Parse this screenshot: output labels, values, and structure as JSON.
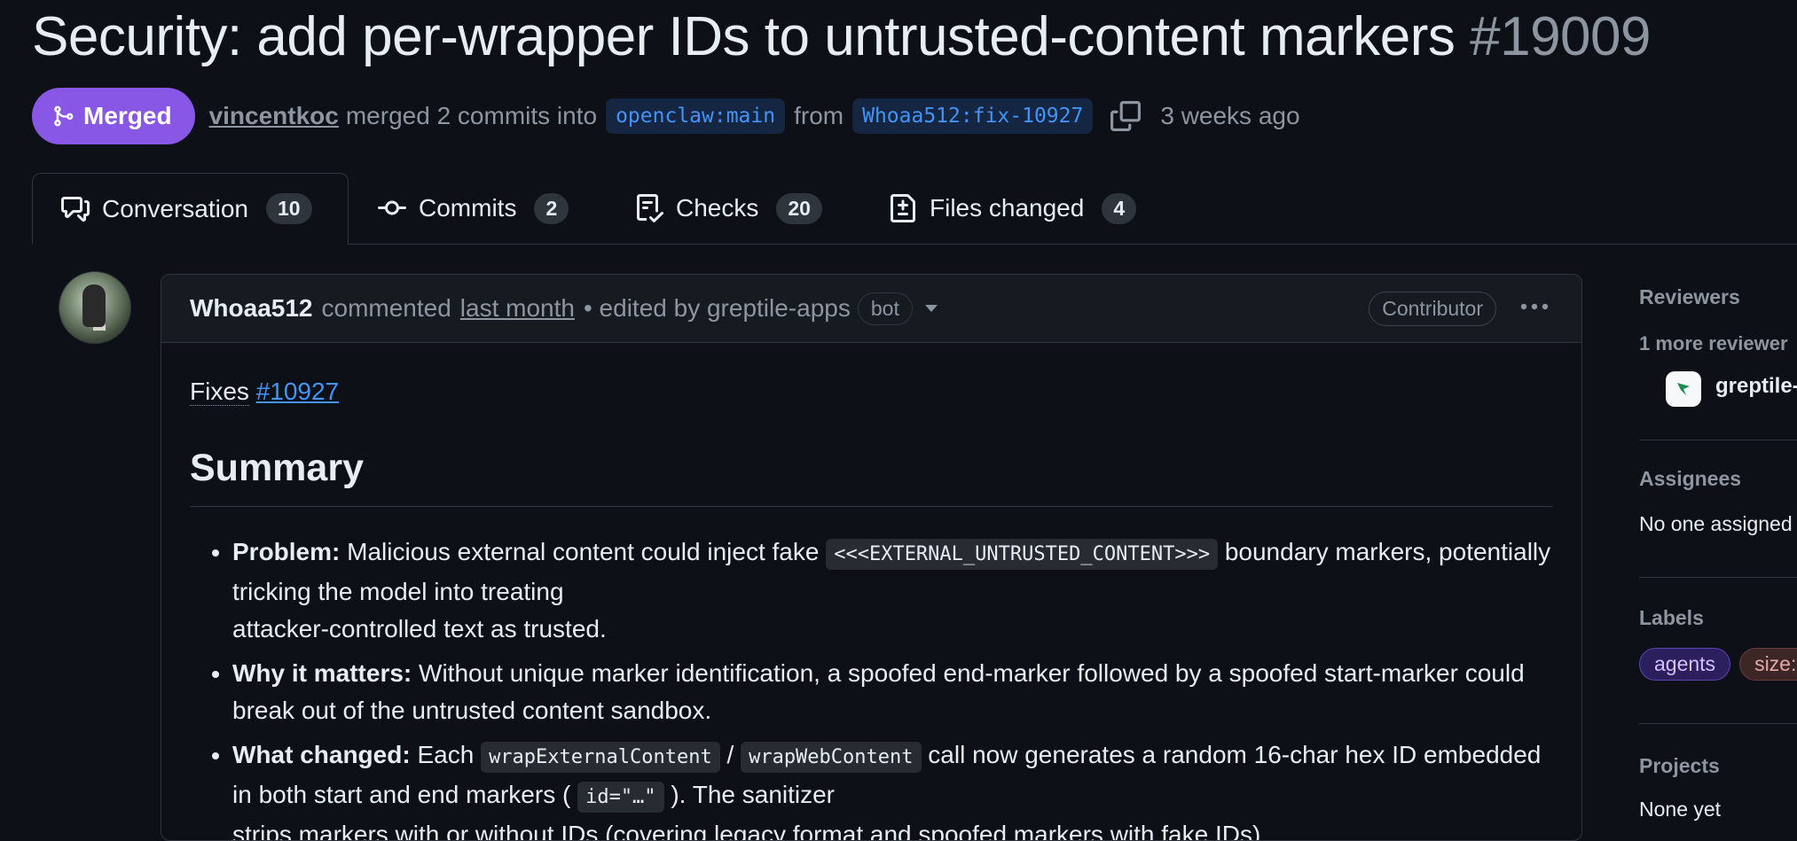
{
  "pr": {
    "title": "Security: add per-wrapper IDs to untrusted-content markers",
    "number": "#19009",
    "state": "Merged",
    "merged_by": "vincentkoc",
    "merged_text": "merged 2 commits into",
    "base_branch": "openclaw:main",
    "from_text": "from",
    "head_branch": "Whoaa512:fix-10927",
    "time": "3 weeks ago"
  },
  "tabs": [
    {
      "label": "Conversation",
      "count": "10",
      "icon": "comment-discussion-icon"
    },
    {
      "label": "Commits",
      "count": "2",
      "icon": "git-commit-icon"
    },
    {
      "label": "Checks",
      "count": "20",
      "icon": "checklist-icon"
    },
    {
      "label": "Files changed",
      "count": "4",
      "icon": "file-diff-icon"
    }
  ],
  "comment": {
    "author": "Whoaa512",
    "commented": "commented",
    "time": "last month",
    "edited": "• edited by greptile-apps",
    "bot_badge": "bot",
    "role_badge": "Contributor",
    "fixes_label": "Fixes",
    "fixes_link": "#10927",
    "summary_heading": "Summary",
    "points": [
      {
        "label": "Problem:",
        "text1": " Malicious external content could inject fake ",
        "code1": "<<<EXTERNAL_UNTRUSTED_CONTENT>>>",
        "text2": " boundary markers, potentially tricking the model into treating",
        "text3": "attacker-controlled text as trusted."
      },
      {
        "label": "Why it matters:",
        "text1": " Without unique marker identification, a spoofed end-marker followed by a spoofed start-marker could break out of the untrusted content sandbox."
      },
      {
        "label": "What changed:",
        "text1": " Each ",
        "code1": "wrapExternalContent",
        "sep": " / ",
        "code2": "wrapWebContent",
        "text2": " call now generates a random 16-char hex ID embedded in both start and end markers ( ",
        "code3": "id=\"…\"",
        "text3": " ). The sanitizer",
        "text4": "strips markers with or without IDs (covering legacy format and spoofed markers with fake IDs)."
      }
    ]
  },
  "sidebar": {
    "reviewers": {
      "heading": "Reviewers",
      "more": "1 more reviewer",
      "name": "greptile-apps"
    },
    "assignees": {
      "heading": "Assignees",
      "value": "No one assigned"
    },
    "labels": {
      "heading": "Labels",
      "items": [
        "agents",
        "size: M"
      ]
    },
    "projects": {
      "heading": "Projects",
      "value": "None yet"
    }
  },
  "colors": {
    "background": "#0d1117",
    "merged_purple": "#8957e5",
    "link_blue": "#4493f8",
    "muted": "#8d96a0",
    "label_agents_bg": "#2c1f5e",
    "label_size_bg": "#3c2626"
  }
}
